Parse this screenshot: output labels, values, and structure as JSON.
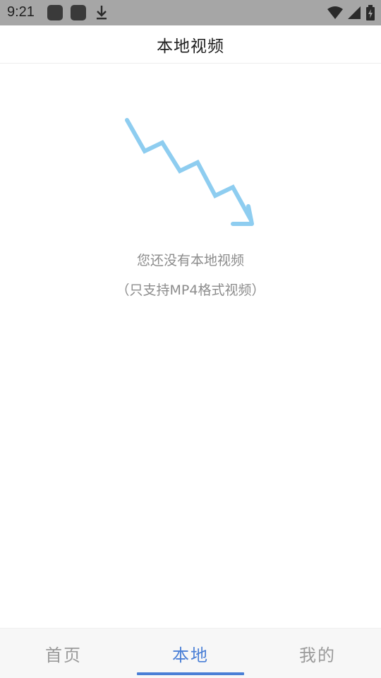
{
  "status_bar": {
    "time": "9:21",
    "icons": [
      "app-icon",
      "app-icon",
      "download-icon",
      "wifi-icon",
      "signal-icon",
      "battery-icon"
    ]
  },
  "header": {
    "title": "本地视频"
  },
  "empty_state": {
    "icon": "arrow-down-zigzag-icon",
    "title": "您还没有本地视频",
    "subtitle": "（只支持MP4格式视频）",
    "accent_color": "#8ecdf0"
  },
  "bottom_nav": {
    "tabs": [
      {
        "label": "首页",
        "active": false
      },
      {
        "label": "本地",
        "active": true
      },
      {
        "label": "我的",
        "active": false
      }
    ],
    "active_color": "#4a7fd6",
    "inactive_color": "#9a9a9a"
  }
}
